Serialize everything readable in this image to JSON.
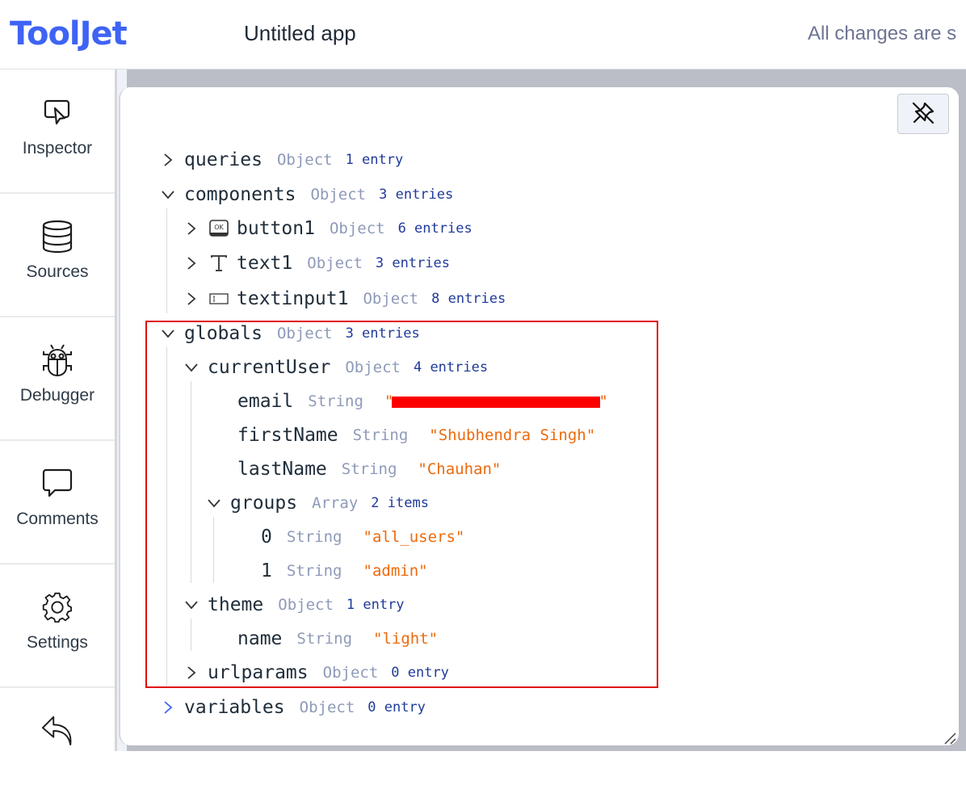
{
  "header": {
    "logo": "ToolJet",
    "app_title": "Untitled app",
    "save_status": "All changes are s"
  },
  "sidebar": {
    "items": [
      {
        "label": "Inspector",
        "icon": "inspector-cursor-icon"
      },
      {
        "label": "Sources",
        "icon": "database-icon"
      },
      {
        "label": "Debugger",
        "icon": "bug-icon"
      },
      {
        "label": "Comments",
        "icon": "comment-icon"
      },
      {
        "label": "Settings",
        "icon": "gear-icon"
      },
      {
        "label": "",
        "icon": "undo-arrow-icon"
      }
    ]
  },
  "inspector": {
    "pin_button": {
      "icon": "unpin-icon"
    },
    "tree": {
      "queries": {
        "key": "queries",
        "type": "Object",
        "count": "1 entry",
        "expanded": false
      },
      "components": {
        "key": "components",
        "type": "Object",
        "count": "3 entries",
        "expanded": true,
        "children": [
          {
            "key": "button1",
            "type": "Object",
            "count": "6 entries",
            "icon": "button-ok-icon"
          },
          {
            "key": "text1",
            "type": "Object",
            "count": "3 entries",
            "icon": "text-icon"
          },
          {
            "key": "textinput1",
            "type": "Object",
            "count": "8 entries",
            "icon": "text-input-icon"
          }
        ]
      },
      "globals": {
        "key": "globals",
        "type": "Object",
        "count": "3 entries",
        "expanded": true,
        "currentUser": {
          "key": "currentUser",
          "type": "Object",
          "count": "4 entries",
          "email": {
            "key": "email",
            "type": "String",
            "value_open": "\"",
            "value_close": "\"",
            "redacted": true
          },
          "firstName": {
            "key": "firstName",
            "type": "String",
            "value": "\"Shubhendra Singh\""
          },
          "lastName": {
            "key": "lastName",
            "type": "String",
            "value": "\"Chauhan\""
          },
          "groups": {
            "key": "groups",
            "type": "Array",
            "count": "2 items",
            "items": [
              {
                "key": "0",
                "type": "String",
                "value": "\"all_users\""
              },
              {
                "key": "1",
                "type": "String",
                "value": "\"admin\""
              }
            ]
          }
        },
        "theme": {
          "key": "theme",
          "type": "Object",
          "count": "1 entry",
          "name": {
            "key": "name",
            "type": "String",
            "value": "\"light\""
          }
        },
        "urlparams": {
          "key": "urlparams",
          "type": "Object",
          "count": "0 entry"
        }
      },
      "variables": {
        "key": "variables",
        "type": "Object",
        "count": "0 entry",
        "expanded": false
      }
    }
  },
  "colors": {
    "brand": "#3e63f5",
    "string_value": "#ec6a0d",
    "count": "#1f3a9a",
    "type": "#8e9ab8",
    "highlight_border": "#e00a0a"
  }
}
